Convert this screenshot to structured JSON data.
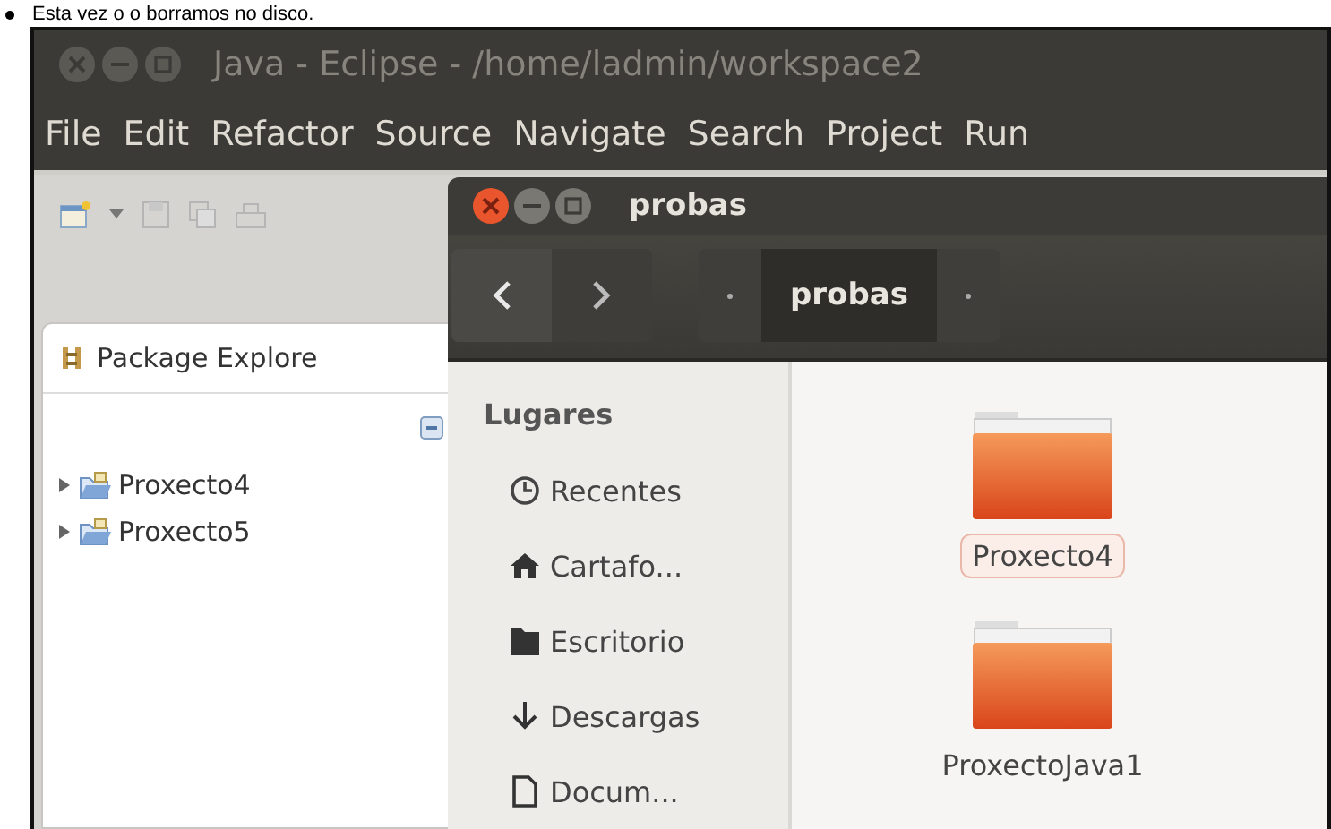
{
  "caption": "Esta vez o o borramos no disco.",
  "eclipse": {
    "title": "Java - Eclipse - /home/ladmin/workspace2",
    "menu": [
      "File",
      "Edit",
      "Refactor",
      "Source",
      "Navigate",
      "Search",
      "Project",
      "Run"
    ],
    "package_explorer": {
      "title": "Package Explore",
      "projects": [
        {
          "name": "Proxecto4",
          "expanded": false
        },
        {
          "name": "Proxecto5",
          "expanded": false
        }
      ]
    }
  },
  "file_manager": {
    "title": "probas",
    "path": [
      {
        "label": "probas",
        "selected": true
      }
    ],
    "sidebar": {
      "heading": "Lugares",
      "items": [
        {
          "label": "Recentes",
          "kind": "recent"
        },
        {
          "label": "Cartafo...",
          "kind": "home"
        },
        {
          "label": "Escritorio",
          "kind": "desktop"
        },
        {
          "label": "Descargas",
          "kind": "download"
        },
        {
          "label": "Docum...",
          "kind": "document"
        }
      ]
    },
    "files": [
      {
        "name": "Proxecto4",
        "selected": true
      },
      {
        "name": "ProxectoJava1",
        "selected": false
      }
    ]
  }
}
